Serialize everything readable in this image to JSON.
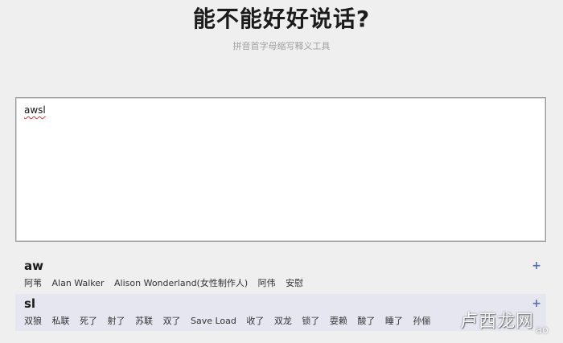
{
  "header": {
    "title": "能不能好好说话?",
    "subtitle": "拼音首字母缩写释义工具"
  },
  "input": {
    "value": "awsl"
  },
  "results": [
    {
      "abbr": "aw",
      "add_icon": "plus-icon",
      "add_label": "+",
      "candidates": [
        "阿苇",
        "Alan Walker",
        "Alison Wonderland(女性制作人)",
        "阿伟",
        "安慰"
      ]
    },
    {
      "abbr": "sl",
      "add_icon": "plus-icon",
      "add_label": "+",
      "candidates": [
        "双狼",
        "私联",
        "死了",
        "射了",
        "苏联",
        "双了",
        "Save Load",
        "收了",
        "双龙",
        "锁了",
        "耍赖",
        "酸了",
        "睡了",
        "孙俪"
      ]
    }
  ],
  "watermark": {
    "text": "卢西龙网",
    "sub": "ao"
  },
  "colors": {
    "background": "#efefef",
    "selected_row": "#e6e6f0",
    "plus_accent": "#5a6fb0"
  }
}
